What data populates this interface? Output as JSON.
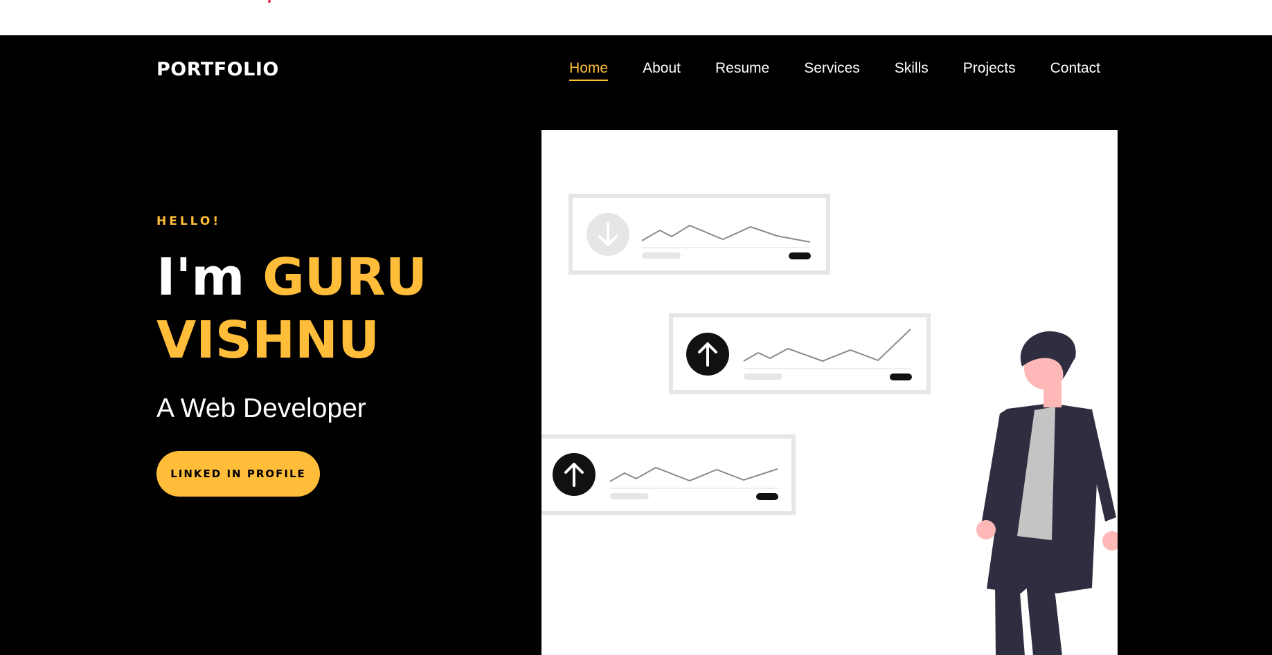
{
  "nav": {
    "brand": "PORTFOLIO",
    "items": [
      {
        "label": "Home",
        "active": true
      },
      {
        "label": "About"
      },
      {
        "label": "Resume"
      },
      {
        "label": "Services"
      },
      {
        "label": "Skills"
      },
      {
        "label": "Projects"
      },
      {
        "label": "Contact"
      }
    ]
  },
  "hero": {
    "greeting": "HELLO!",
    "intro": "I'm",
    "first_name": "GURU",
    "last_name": "VISHNU",
    "subtitle": "A Web Developer",
    "cta_label": "LINKED IN PROFILE"
  },
  "colors": {
    "accent": "#ffbd39",
    "background": "#000000",
    "text": "#ffffff"
  },
  "illustration": {
    "icons": [
      "arrow-down-icon",
      "arrow-up-icon",
      "arrow-up-icon"
    ]
  }
}
